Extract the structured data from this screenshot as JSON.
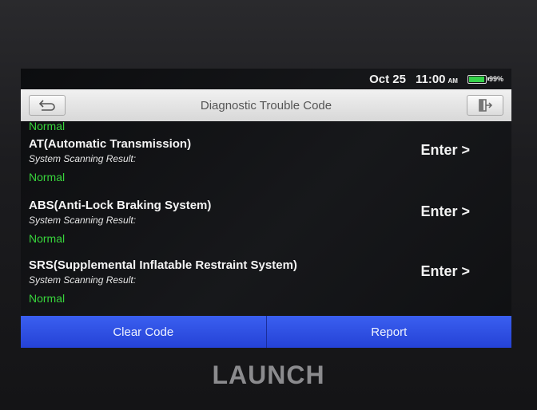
{
  "status": {
    "date": "Oct 25",
    "time": "11:00",
    "ampm": "AM",
    "battery_pct": "99%",
    "battery_level": 0.99,
    "battery_color": "#35d24a"
  },
  "titlebar": {
    "title": "Diagnostic Trouble Code",
    "back_icon": "back-icon",
    "exit_icon": "exit-icon"
  },
  "list": {
    "clipped_result": "Normal",
    "items": [
      {
        "name": "AT(Automatic Transmission)",
        "sublabel": "System Scanning Result:",
        "result": "Normal",
        "enter": "Enter >"
      },
      {
        "name": "ABS(Anti-Lock Braking System)",
        "sublabel": "System Scanning Result:",
        "result": "Normal",
        "enter": "Enter >"
      },
      {
        "name": "SRS(Supplemental Inflatable Restraint System)",
        "sublabel": "System Scanning Result:",
        "result": "Normal",
        "enter": "Enter >"
      }
    ]
  },
  "bottombar": {
    "clear_code": "Clear Code",
    "report": "Report",
    "accent": "#2f4fe6"
  },
  "device": {
    "brand": "LAUNCH"
  }
}
